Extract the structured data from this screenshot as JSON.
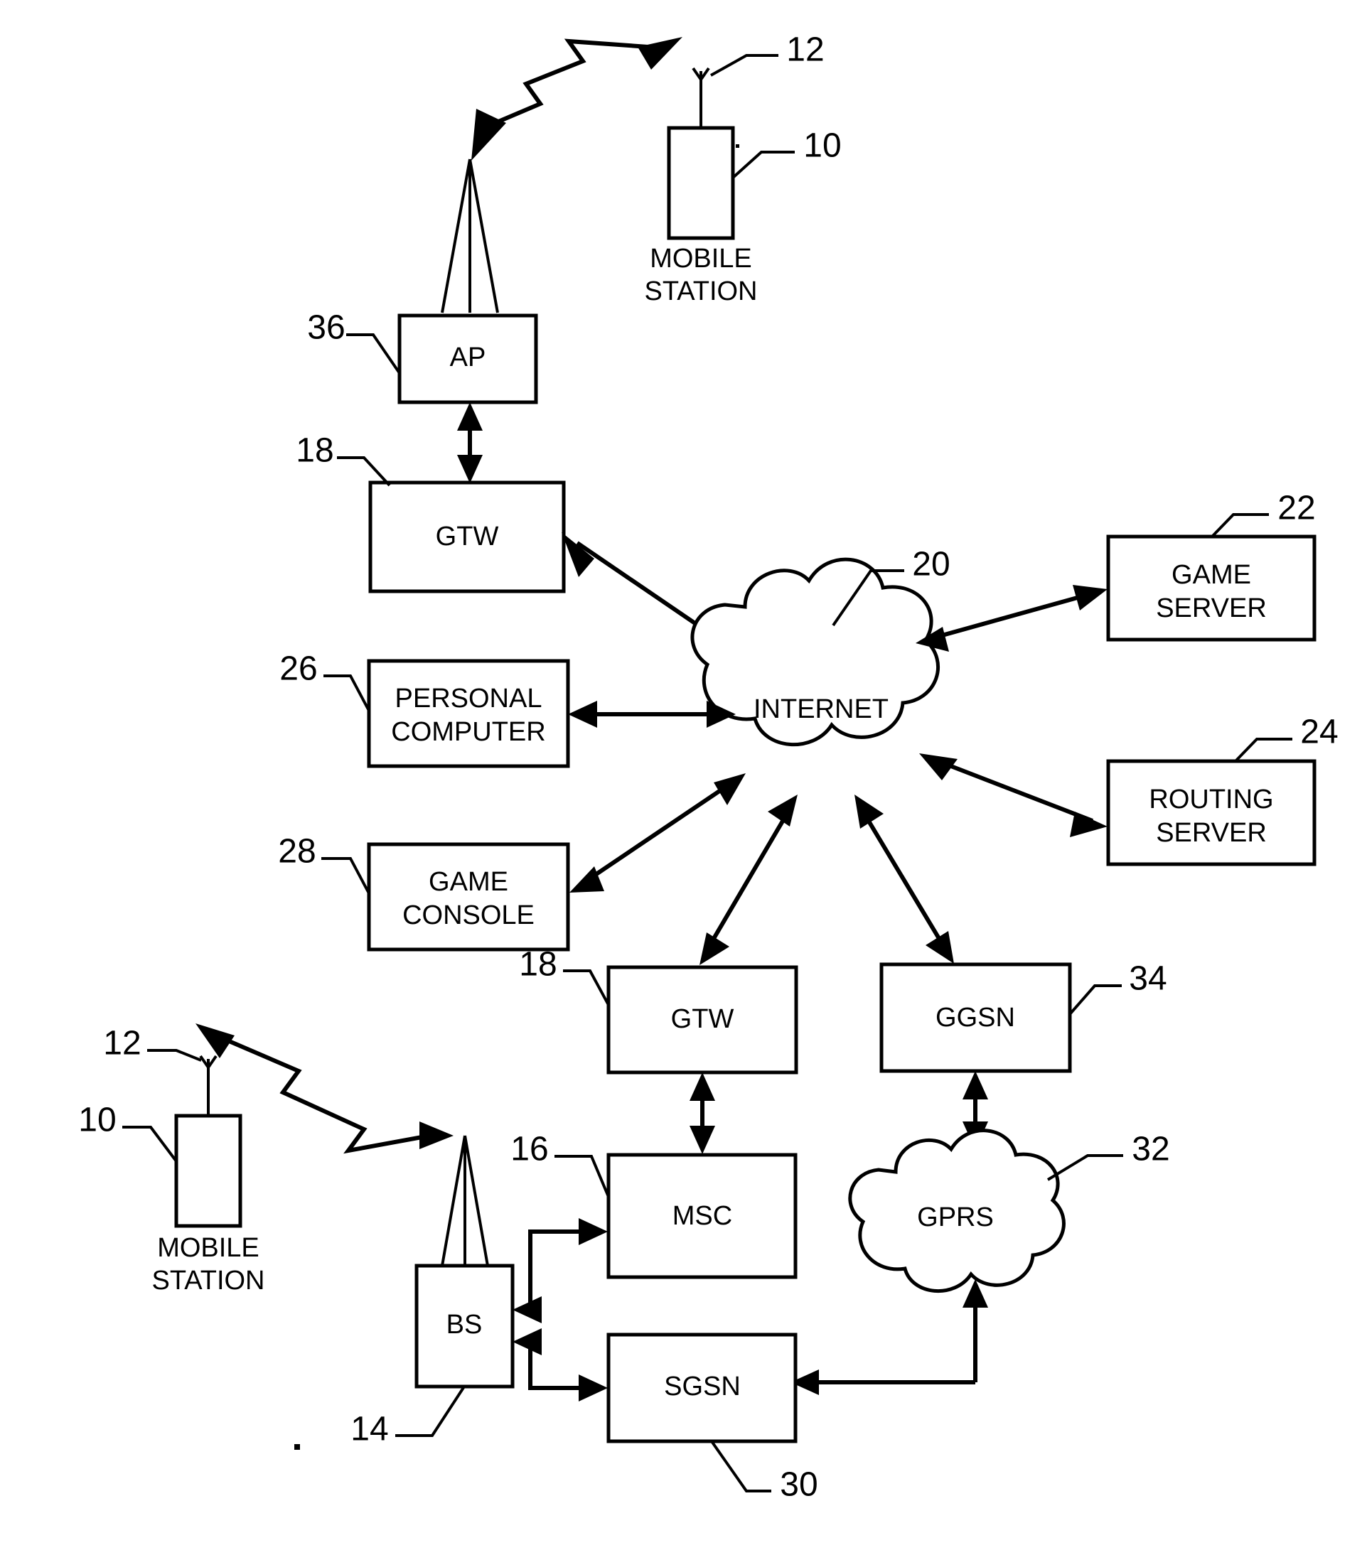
{
  "figure": {
    "kind": "patent-network-diagram",
    "background_color": "#ffffff",
    "line_color": "#000000"
  },
  "nodes": {
    "ap": {
      "label": "AP",
      "ref": "36"
    },
    "gtw_top": {
      "label": "GTW",
      "ref": "18"
    },
    "internet": {
      "label": "INTERNET",
      "ref": "20"
    },
    "game_server": {
      "label_line1": "GAME",
      "label_line2": "SERVER",
      "ref": "22"
    },
    "routing_server": {
      "label_line1": "ROUTING",
      "label_line2": "SERVER",
      "ref": "24"
    },
    "personal_computer": {
      "label_line1": "PERSONAL",
      "label_line2": "COMPUTER",
      "ref": "26"
    },
    "game_console": {
      "label_line1": "GAME",
      "label_line2": "CONSOLE",
      "ref": "28"
    },
    "gtw_bottom": {
      "label": "GTW",
      "ref": "18"
    },
    "ggsn": {
      "label": "GGSN",
      "ref": "34"
    },
    "msc": {
      "label": "MSC",
      "ref": "16"
    },
    "sgsn": {
      "label": "SGSN",
      "ref": "30"
    },
    "gprs": {
      "label": "GPRS",
      "ref": "32"
    },
    "bs": {
      "label": "BS",
      "ref": "14"
    },
    "mobile_station_top": {
      "caption_line1": "MOBILE",
      "caption_line2": "STATION",
      "ref_body": "10",
      "ref_antenna": "12"
    },
    "mobile_station_bottom": {
      "caption_line1": "MOBILE",
      "caption_line2": "STATION",
      "ref_body": "10",
      "ref_antenna": "12"
    }
  },
  "reference_numerals": [
    {
      "id": "12",
      "value": "12",
      "points_to": "antenna of top mobile station"
    },
    {
      "id": "10",
      "value": "10",
      "points_to": "top mobile station body"
    },
    {
      "id": "36",
      "value": "36",
      "points_to": "AP"
    },
    {
      "id": "18-top",
      "value": "18",
      "points_to": "top GTW"
    },
    {
      "id": "20",
      "value": "20",
      "points_to": "INTERNET cloud"
    },
    {
      "id": "22",
      "value": "22",
      "points_to": "GAME SERVER"
    },
    {
      "id": "24",
      "value": "24",
      "points_to": "ROUTING SERVER"
    },
    {
      "id": "26",
      "value": "26",
      "points_to": "PERSONAL COMPUTER"
    },
    {
      "id": "28",
      "value": "28",
      "points_to": "GAME CONSOLE"
    },
    {
      "id": "18-bottom",
      "value": "18",
      "points_to": "bottom GTW"
    },
    {
      "id": "34",
      "value": "34",
      "points_to": "GGSN"
    },
    {
      "id": "12-b",
      "value": "12",
      "points_to": "antenna of bottom mobile station"
    },
    {
      "id": "10-b",
      "value": "10",
      "points_to": "bottom mobile station body"
    },
    {
      "id": "16",
      "value": "16",
      "points_to": "MSC"
    },
    {
      "id": "32",
      "value": "32",
      "points_to": "GPRS cloud"
    },
    {
      "id": "14",
      "value": "14",
      "points_to": "BS"
    },
    {
      "id": "30",
      "value": "30",
      "points_to": "SGSN"
    }
  ],
  "connections": [
    {
      "from": "mobile_station_top",
      "to": "ap",
      "style": "radio-zigzag",
      "direction": "bidirectional"
    },
    {
      "from": "ap",
      "to": "gtw_top",
      "style": "line",
      "direction": "bidirectional"
    },
    {
      "from": "gtw_top",
      "to": "internet",
      "style": "line",
      "direction": "bidirectional"
    },
    {
      "from": "internet",
      "to": "game_server",
      "style": "line",
      "direction": "bidirectional"
    },
    {
      "from": "internet",
      "to": "routing_server",
      "style": "line",
      "direction": "bidirectional"
    },
    {
      "from": "personal_computer",
      "to": "internet",
      "style": "line",
      "direction": "bidirectional"
    },
    {
      "from": "game_console",
      "to": "internet",
      "style": "line",
      "direction": "bidirectional"
    },
    {
      "from": "internet",
      "to": "gtw_bottom",
      "style": "line",
      "direction": "bidirectional"
    },
    {
      "from": "internet",
      "to": "ggsn",
      "style": "line",
      "direction": "bidirectional"
    },
    {
      "from": "gtw_bottom",
      "to": "msc",
      "style": "line",
      "direction": "bidirectional"
    },
    {
      "from": "ggsn",
      "to": "gprs",
      "style": "line",
      "direction": "bidirectional"
    },
    {
      "from": "gprs",
      "to": "sgsn",
      "style": "line",
      "direction": "unidirectional"
    },
    {
      "from": "msc",
      "to": "bs",
      "style": "elbow",
      "direction": "bidirectional"
    },
    {
      "from": "sgsn",
      "to": "bs",
      "style": "elbow",
      "direction": "bidirectional"
    },
    {
      "from": "bs",
      "to": "mobile_station_bottom",
      "style": "radio-zigzag",
      "direction": "bidirectional"
    }
  ]
}
